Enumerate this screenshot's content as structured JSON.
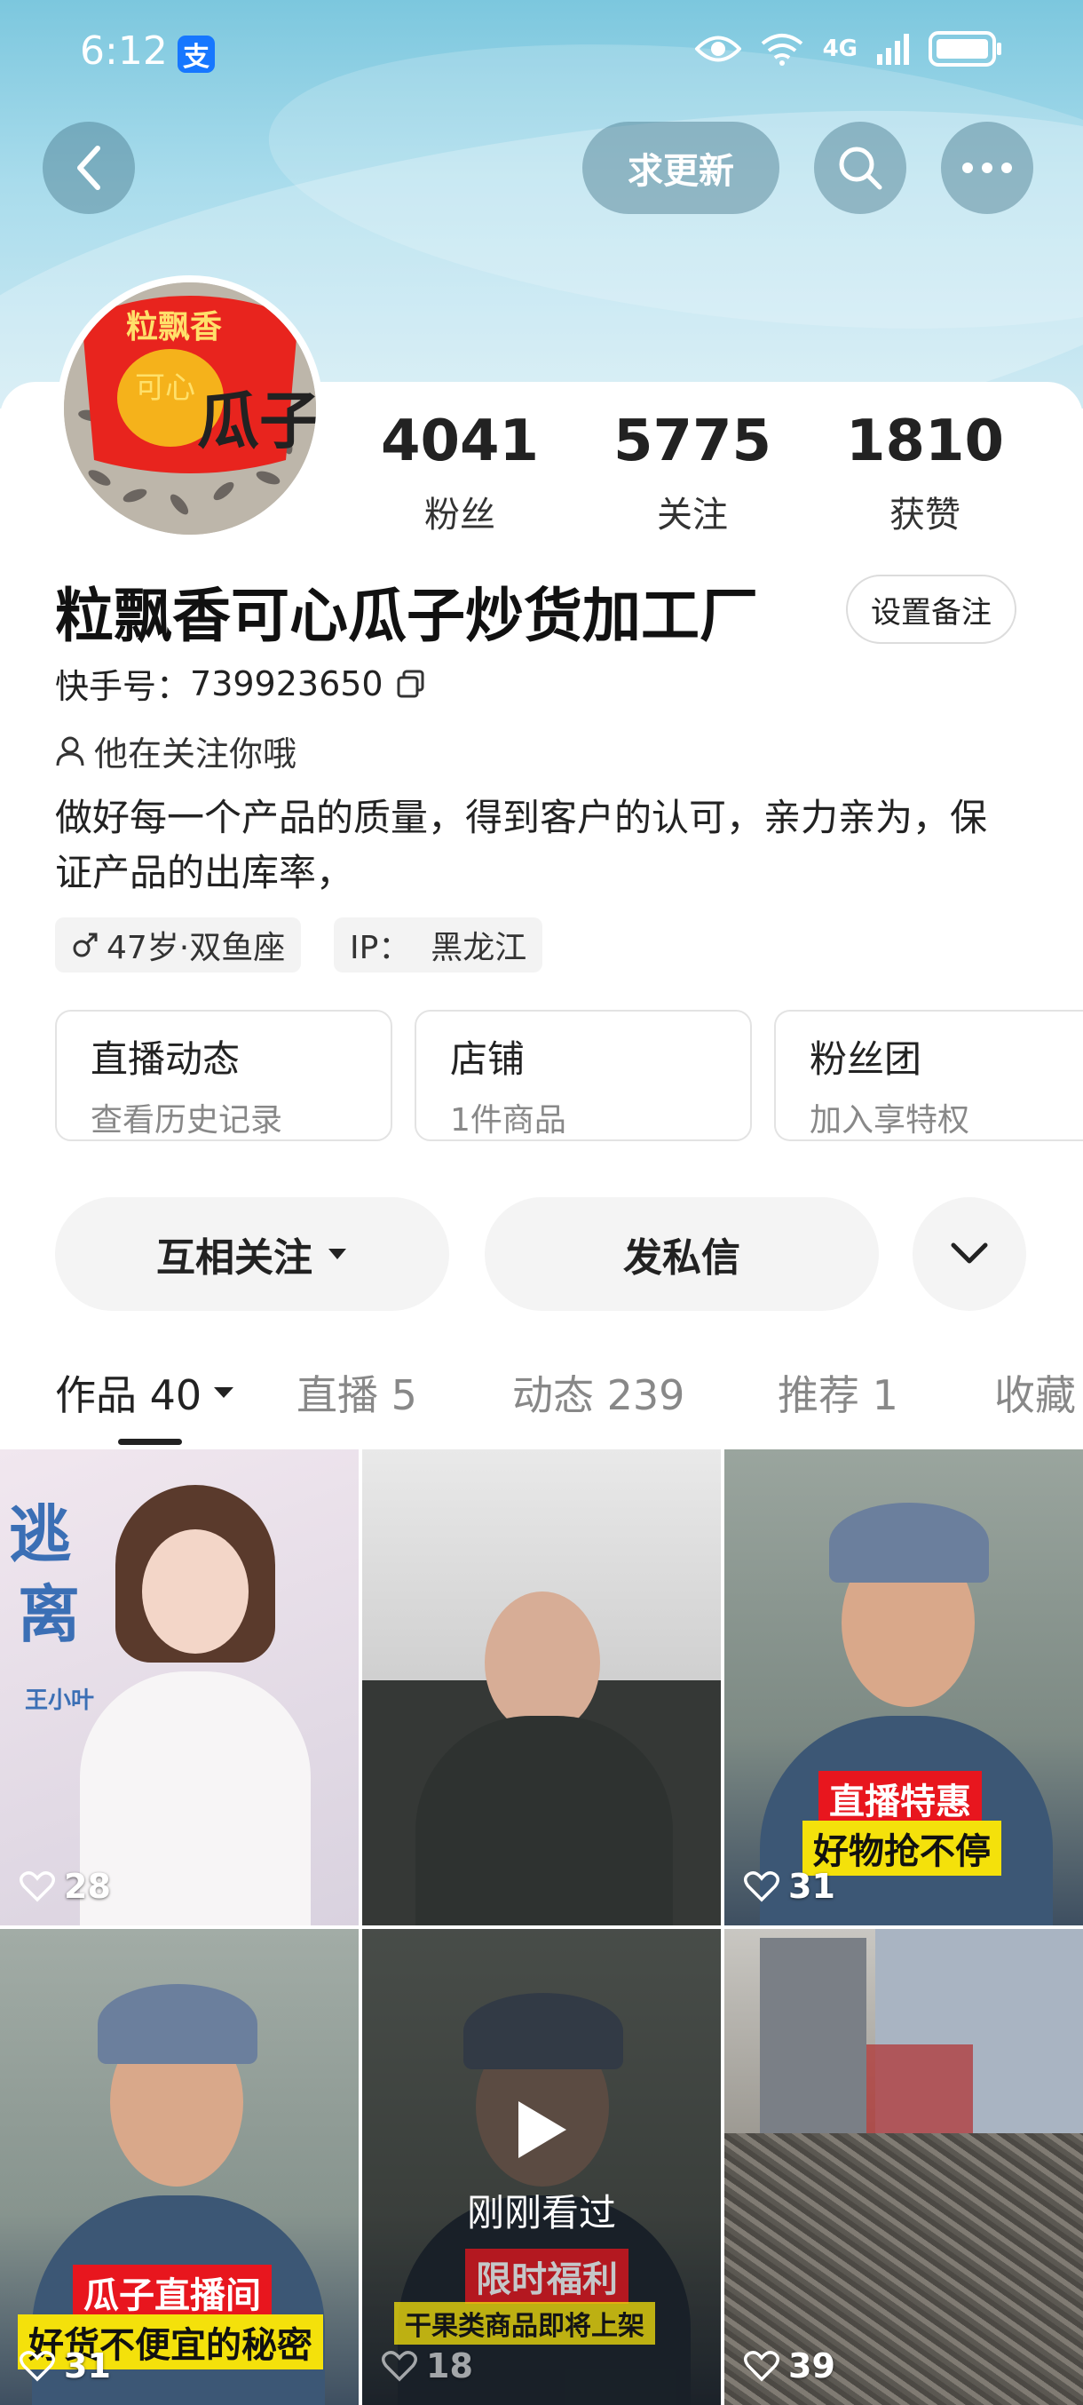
{
  "status_bar": {
    "time": "6:12",
    "alipay_badge": "支",
    "network": "4G"
  },
  "header": {
    "update_button": "求更新"
  },
  "profile": {
    "stats": [
      {
        "value": "4041",
        "label": "粉丝"
      },
      {
        "value": "5775",
        "label": "关注"
      },
      {
        "value": "1810",
        "label": "获赞"
      }
    ],
    "avatar_text": [
      "粒飘香",
      "可心",
      "瓜子"
    ],
    "name": "粒飘香可心瓜子炒货加工厂",
    "remark_button": "设置备注",
    "kuaishou_id_label": "快手号：",
    "kuaishou_id": "739923650",
    "follow_note": "他在关注你哦",
    "bio": "做好每一个产品的质量，得到客户的认可，亲力亲为，保证产品的出库率，",
    "tags": [
      "47岁·双鱼座",
      "IP：  黑龙江"
    ],
    "info_cards": [
      {
        "title": "直播动态",
        "sub": "查看历史记录"
      },
      {
        "title": "店铺",
        "sub": "1件商品"
      },
      {
        "title": "粉丝团",
        "sub": "加入享特权"
      }
    ],
    "actions": {
      "mutual_follow": "互相关注",
      "message": "发私信"
    }
  },
  "tabs": [
    {
      "label": "作品 40"
    },
    {
      "label": "直播 5"
    },
    {
      "label": "动态 239"
    },
    {
      "label": "推荐 1"
    },
    {
      "label": "收藏"
    }
  ],
  "videos": [
    {
      "likes": "28",
      "captions": [
        "王小叶"
      ]
    },
    {
      "likes": "",
      "captions": []
    },
    {
      "likes": "31",
      "captions": [
        "直播特惠",
        "好物抢不停"
      ]
    },
    {
      "likes": "31",
      "captions": [
        "瓜子直播间",
        "好货不便宜的秘密"
      ]
    },
    {
      "likes": "18",
      "captions": [
        "刚刚看过",
        "限时福利",
        "干果类商品即将上架"
      ]
    },
    {
      "likes": "39",
      "captions": []
    }
  ],
  "colors": {
    "accent_blue": "#1677ff",
    "caption_red": "#e8161e",
    "caption_yellow": "#f4e10b"
  }
}
